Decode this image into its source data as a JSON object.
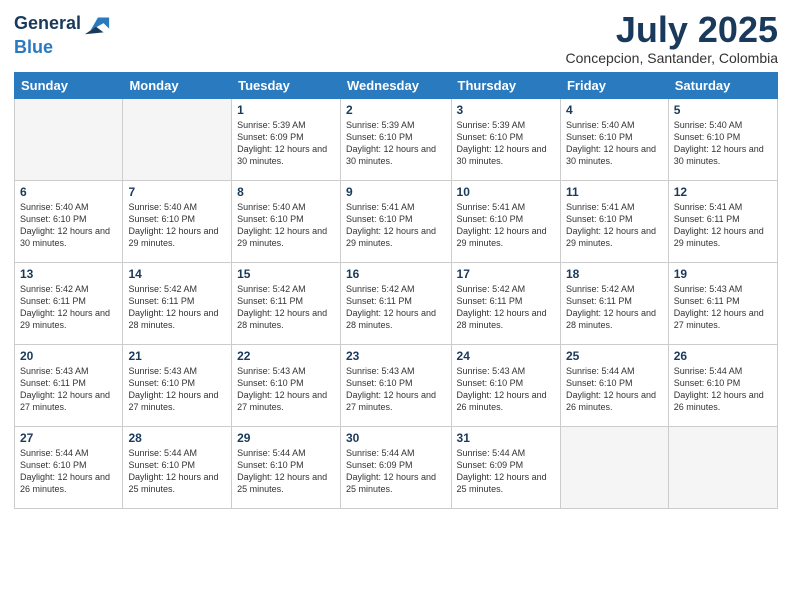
{
  "logo": {
    "line1": "General",
    "line2": "Blue"
  },
  "title": "July 2025",
  "subtitle": "Concepcion, Santander, Colombia",
  "days_of_week": [
    "Sunday",
    "Monday",
    "Tuesday",
    "Wednesday",
    "Thursday",
    "Friday",
    "Saturday"
  ],
  "weeks": [
    [
      {
        "num": "",
        "empty": true
      },
      {
        "num": "",
        "empty": true
      },
      {
        "num": "1",
        "sunrise": "5:39 AM",
        "sunset": "6:09 PM",
        "daylight": "12 hours and 30 minutes."
      },
      {
        "num": "2",
        "sunrise": "5:39 AM",
        "sunset": "6:10 PM",
        "daylight": "12 hours and 30 minutes."
      },
      {
        "num": "3",
        "sunrise": "5:39 AM",
        "sunset": "6:10 PM",
        "daylight": "12 hours and 30 minutes."
      },
      {
        "num": "4",
        "sunrise": "5:40 AM",
        "sunset": "6:10 PM",
        "daylight": "12 hours and 30 minutes."
      },
      {
        "num": "5",
        "sunrise": "5:40 AM",
        "sunset": "6:10 PM",
        "daylight": "12 hours and 30 minutes."
      }
    ],
    [
      {
        "num": "6",
        "sunrise": "5:40 AM",
        "sunset": "6:10 PM",
        "daylight": "12 hours and 30 minutes."
      },
      {
        "num": "7",
        "sunrise": "5:40 AM",
        "sunset": "6:10 PM",
        "daylight": "12 hours and 29 minutes."
      },
      {
        "num": "8",
        "sunrise": "5:40 AM",
        "sunset": "6:10 PM",
        "daylight": "12 hours and 29 minutes."
      },
      {
        "num": "9",
        "sunrise": "5:41 AM",
        "sunset": "6:10 PM",
        "daylight": "12 hours and 29 minutes."
      },
      {
        "num": "10",
        "sunrise": "5:41 AM",
        "sunset": "6:10 PM",
        "daylight": "12 hours and 29 minutes."
      },
      {
        "num": "11",
        "sunrise": "5:41 AM",
        "sunset": "6:10 PM",
        "daylight": "12 hours and 29 minutes."
      },
      {
        "num": "12",
        "sunrise": "5:41 AM",
        "sunset": "6:11 PM",
        "daylight": "12 hours and 29 minutes."
      }
    ],
    [
      {
        "num": "13",
        "sunrise": "5:42 AM",
        "sunset": "6:11 PM",
        "daylight": "12 hours and 29 minutes."
      },
      {
        "num": "14",
        "sunrise": "5:42 AM",
        "sunset": "6:11 PM",
        "daylight": "12 hours and 28 minutes."
      },
      {
        "num": "15",
        "sunrise": "5:42 AM",
        "sunset": "6:11 PM",
        "daylight": "12 hours and 28 minutes."
      },
      {
        "num": "16",
        "sunrise": "5:42 AM",
        "sunset": "6:11 PM",
        "daylight": "12 hours and 28 minutes."
      },
      {
        "num": "17",
        "sunrise": "5:42 AM",
        "sunset": "6:11 PM",
        "daylight": "12 hours and 28 minutes."
      },
      {
        "num": "18",
        "sunrise": "5:42 AM",
        "sunset": "6:11 PM",
        "daylight": "12 hours and 28 minutes."
      },
      {
        "num": "19",
        "sunrise": "5:43 AM",
        "sunset": "6:11 PM",
        "daylight": "12 hours and 27 minutes."
      }
    ],
    [
      {
        "num": "20",
        "sunrise": "5:43 AM",
        "sunset": "6:11 PM",
        "daylight": "12 hours and 27 minutes."
      },
      {
        "num": "21",
        "sunrise": "5:43 AM",
        "sunset": "6:10 PM",
        "daylight": "12 hours and 27 minutes."
      },
      {
        "num": "22",
        "sunrise": "5:43 AM",
        "sunset": "6:10 PM",
        "daylight": "12 hours and 27 minutes."
      },
      {
        "num": "23",
        "sunrise": "5:43 AM",
        "sunset": "6:10 PM",
        "daylight": "12 hours and 27 minutes."
      },
      {
        "num": "24",
        "sunrise": "5:43 AM",
        "sunset": "6:10 PM",
        "daylight": "12 hours and 26 minutes."
      },
      {
        "num": "25",
        "sunrise": "5:44 AM",
        "sunset": "6:10 PM",
        "daylight": "12 hours and 26 minutes."
      },
      {
        "num": "26",
        "sunrise": "5:44 AM",
        "sunset": "6:10 PM",
        "daylight": "12 hours and 26 minutes."
      }
    ],
    [
      {
        "num": "27",
        "sunrise": "5:44 AM",
        "sunset": "6:10 PM",
        "daylight": "12 hours and 26 minutes."
      },
      {
        "num": "28",
        "sunrise": "5:44 AM",
        "sunset": "6:10 PM",
        "daylight": "12 hours and 25 minutes."
      },
      {
        "num": "29",
        "sunrise": "5:44 AM",
        "sunset": "6:10 PM",
        "daylight": "12 hours and 25 minutes."
      },
      {
        "num": "30",
        "sunrise": "5:44 AM",
        "sunset": "6:09 PM",
        "daylight": "12 hours and 25 minutes."
      },
      {
        "num": "31",
        "sunrise": "5:44 AM",
        "sunset": "6:09 PM",
        "daylight": "12 hours and 25 minutes."
      },
      {
        "num": "",
        "empty": true
      },
      {
        "num": "",
        "empty": true
      }
    ]
  ]
}
